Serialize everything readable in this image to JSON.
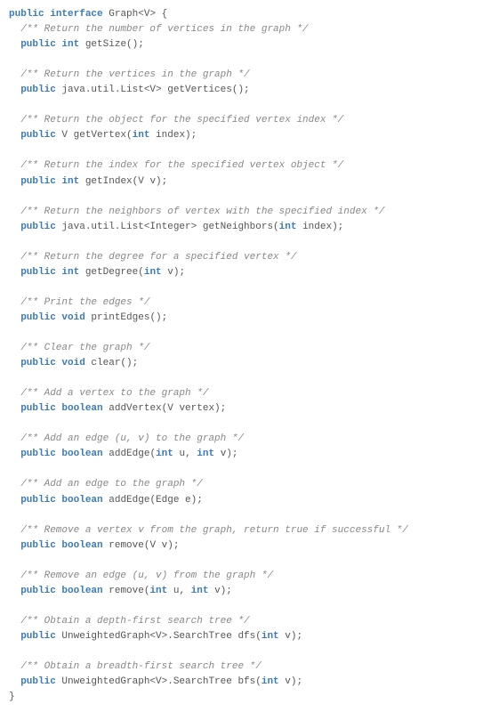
{
  "code": {
    "header": {
      "kw1": "public",
      "kw2": "interface",
      "name": "Graph<V> {"
    },
    "m1": {
      "cm": "/** Return the number of vertices in the graph */",
      "kw1": "public",
      "kw2": "int",
      "rest": " getSize();"
    },
    "m2": {
      "cm": "/** Return the vertices in the graph */",
      "kw1": "public",
      "rest": " java.util.List<V> getVertices();"
    },
    "m3": {
      "cm": "/** Return the object for the specified vertex index */",
      "kw1": "public",
      "rest1": " V getVertex(",
      "kw2": "int",
      "rest2": " index);"
    },
    "m4": {
      "cm": "/** Return the index for the specified vertex object */",
      "kw1": "public",
      "kw2": "int",
      "rest": " getIndex(V v);"
    },
    "m5": {
      "cm": "/** Return the neighbors of vertex with the specified index */",
      "kw1": "public",
      "rest1": " java.util.List<Integer> getNeighbors(",
      "kw2": "int",
      "rest2": " index);"
    },
    "m6": {
      "cm": "/** Return the degree for a specified vertex */",
      "kw1": "public",
      "kw2": "int",
      "rest1": " getDegree(",
      "kw3": "int",
      "rest2": " v);"
    },
    "m7": {
      "cm": "/** Print the edges */",
      "kw1": "public",
      "kw2": "void",
      "rest": " printEdges();"
    },
    "m8": {
      "cm": "/** Clear the graph */",
      "kw1": "public",
      "kw2": "void",
      "rest": " clear();"
    },
    "m9": {
      "cm": "/** Add a vertex to the graph */",
      "kw1": "public",
      "kw2": "boolean",
      "rest": " addVertex(V vertex);"
    },
    "m10": {
      "cm": "/** Add an edge (u, v) to the graph */",
      "kw1": "public",
      "kw2": "boolean",
      "rest1": " addEdge(",
      "kw3": "int",
      "rest2": " u, ",
      "kw4": "int",
      "rest3": " v);"
    },
    "m11": {
      "cm": "/** Add an edge to the graph */",
      "kw1": "public",
      "kw2": "boolean",
      "rest": " addEdge(Edge e);"
    },
    "m12": {
      "cm": "/** Remove a vertex v from the graph, return true if successful */",
      "kw1": "public",
      "kw2": "boolean",
      "rest": " remove(V v);"
    },
    "m13": {
      "cm": "/** Remove an edge (u, v) from the graph */",
      "kw1": "public",
      "kw2": "boolean",
      "rest1": " remove(",
      "kw3": "int",
      "rest2": " u, ",
      "kw4": "int",
      "rest3": " v);"
    },
    "m14": {
      "cm": "/** Obtain a depth-first search tree */",
      "kw1": "public",
      "rest1": " UnweightedGraph<V>.SearchTree dfs(",
      "kw2": "int",
      "rest2": " v);"
    },
    "m15": {
      "cm": "/** Obtain a breadth-first search tree */",
      "kw1": "public",
      "rest1": " UnweightedGraph<V>.SearchTree bfs(",
      "kw2": "int",
      "rest2": " v);"
    },
    "close": "}"
  }
}
